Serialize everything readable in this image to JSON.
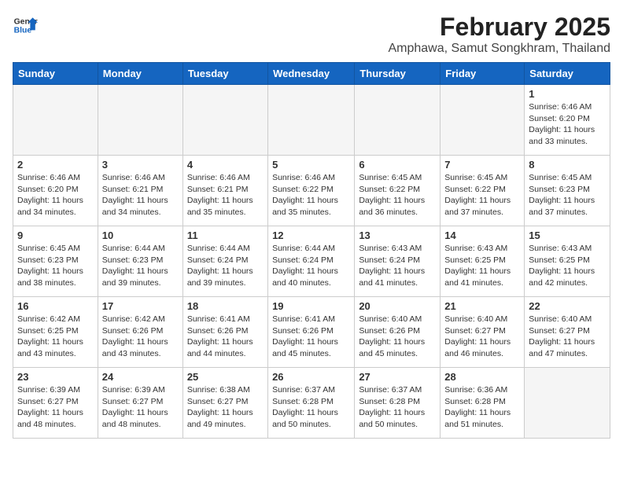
{
  "header": {
    "logo_line1": "General",
    "logo_line2": "Blue",
    "title": "February 2025",
    "subtitle": "Amphawa, Samut Songkhram, Thailand"
  },
  "calendar": {
    "days_of_week": [
      "Sunday",
      "Monday",
      "Tuesday",
      "Wednesday",
      "Thursday",
      "Friday",
      "Saturday"
    ],
    "weeks": [
      {
        "days": [
          {
            "number": "",
            "info": "",
            "empty": true
          },
          {
            "number": "",
            "info": "",
            "empty": true
          },
          {
            "number": "",
            "info": "",
            "empty": true
          },
          {
            "number": "",
            "info": "",
            "empty": true
          },
          {
            "number": "",
            "info": "",
            "empty": true
          },
          {
            "number": "",
            "info": "",
            "empty": true
          },
          {
            "number": "1",
            "info": "Sunrise: 6:46 AM\nSunset: 6:20 PM\nDaylight: 11 hours\nand 33 minutes.",
            "empty": false
          }
        ]
      },
      {
        "days": [
          {
            "number": "2",
            "info": "Sunrise: 6:46 AM\nSunset: 6:20 PM\nDaylight: 11 hours\nand 34 minutes.",
            "empty": false
          },
          {
            "number": "3",
            "info": "Sunrise: 6:46 AM\nSunset: 6:21 PM\nDaylight: 11 hours\nand 34 minutes.",
            "empty": false
          },
          {
            "number": "4",
            "info": "Sunrise: 6:46 AM\nSunset: 6:21 PM\nDaylight: 11 hours\nand 35 minutes.",
            "empty": false
          },
          {
            "number": "5",
            "info": "Sunrise: 6:46 AM\nSunset: 6:22 PM\nDaylight: 11 hours\nand 35 minutes.",
            "empty": false
          },
          {
            "number": "6",
            "info": "Sunrise: 6:45 AM\nSunset: 6:22 PM\nDaylight: 11 hours\nand 36 minutes.",
            "empty": false
          },
          {
            "number": "7",
            "info": "Sunrise: 6:45 AM\nSunset: 6:22 PM\nDaylight: 11 hours\nand 37 minutes.",
            "empty": false
          },
          {
            "number": "8",
            "info": "Sunrise: 6:45 AM\nSunset: 6:23 PM\nDaylight: 11 hours\nand 37 minutes.",
            "empty": false
          }
        ]
      },
      {
        "days": [
          {
            "number": "9",
            "info": "Sunrise: 6:45 AM\nSunset: 6:23 PM\nDaylight: 11 hours\nand 38 minutes.",
            "empty": false
          },
          {
            "number": "10",
            "info": "Sunrise: 6:44 AM\nSunset: 6:23 PM\nDaylight: 11 hours\nand 39 minutes.",
            "empty": false
          },
          {
            "number": "11",
            "info": "Sunrise: 6:44 AM\nSunset: 6:24 PM\nDaylight: 11 hours\nand 39 minutes.",
            "empty": false
          },
          {
            "number": "12",
            "info": "Sunrise: 6:44 AM\nSunset: 6:24 PM\nDaylight: 11 hours\nand 40 minutes.",
            "empty": false
          },
          {
            "number": "13",
            "info": "Sunrise: 6:43 AM\nSunset: 6:24 PM\nDaylight: 11 hours\nand 41 minutes.",
            "empty": false
          },
          {
            "number": "14",
            "info": "Sunrise: 6:43 AM\nSunset: 6:25 PM\nDaylight: 11 hours\nand 41 minutes.",
            "empty": false
          },
          {
            "number": "15",
            "info": "Sunrise: 6:43 AM\nSunset: 6:25 PM\nDaylight: 11 hours\nand 42 minutes.",
            "empty": false
          }
        ]
      },
      {
        "days": [
          {
            "number": "16",
            "info": "Sunrise: 6:42 AM\nSunset: 6:25 PM\nDaylight: 11 hours\nand 43 minutes.",
            "empty": false
          },
          {
            "number": "17",
            "info": "Sunrise: 6:42 AM\nSunset: 6:26 PM\nDaylight: 11 hours\nand 43 minutes.",
            "empty": false
          },
          {
            "number": "18",
            "info": "Sunrise: 6:41 AM\nSunset: 6:26 PM\nDaylight: 11 hours\nand 44 minutes.",
            "empty": false
          },
          {
            "number": "19",
            "info": "Sunrise: 6:41 AM\nSunset: 6:26 PM\nDaylight: 11 hours\nand 45 minutes.",
            "empty": false
          },
          {
            "number": "20",
            "info": "Sunrise: 6:40 AM\nSunset: 6:26 PM\nDaylight: 11 hours\nand 45 minutes.",
            "empty": false
          },
          {
            "number": "21",
            "info": "Sunrise: 6:40 AM\nSunset: 6:27 PM\nDaylight: 11 hours\nand 46 minutes.",
            "empty": false
          },
          {
            "number": "22",
            "info": "Sunrise: 6:40 AM\nSunset: 6:27 PM\nDaylight: 11 hours\nand 47 minutes.",
            "empty": false
          }
        ]
      },
      {
        "days": [
          {
            "number": "23",
            "info": "Sunrise: 6:39 AM\nSunset: 6:27 PM\nDaylight: 11 hours\nand 48 minutes.",
            "empty": false
          },
          {
            "number": "24",
            "info": "Sunrise: 6:39 AM\nSunset: 6:27 PM\nDaylight: 11 hours\nand 48 minutes.",
            "empty": false
          },
          {
            "number": "25",
            "info": "Sunrise: 6:38 AM\nSunset: 6:27 PM\nDaylight: 11 hours\nand 49 minutes.",
            "empty": false
          },
          {
            "number": "26",
            "info": "Sunrise: 6:37 AM\nSunset: 6:28 PM\nDaylight: 11 hours\nand 50 minutes.",
            "empty": false
          },
          {
            "number": "27",
            "info": "Sunrise: 6:37 AM\nSunset: 6:28 PM\nDaylight: 11 hours\nand 50 minutes.",
            "empty": false
          },
          {
            "number": "28",
            "info": "Sunrise: 6:36 AM\nSunset: 6:28 PM\nDaylight: 11 hours\nand 51 minutes.",
            "empty": false
          },
          {
            "number": "",
            "info": "",
            "empty": true
          }
        ]
      }
    ]
  }
}
